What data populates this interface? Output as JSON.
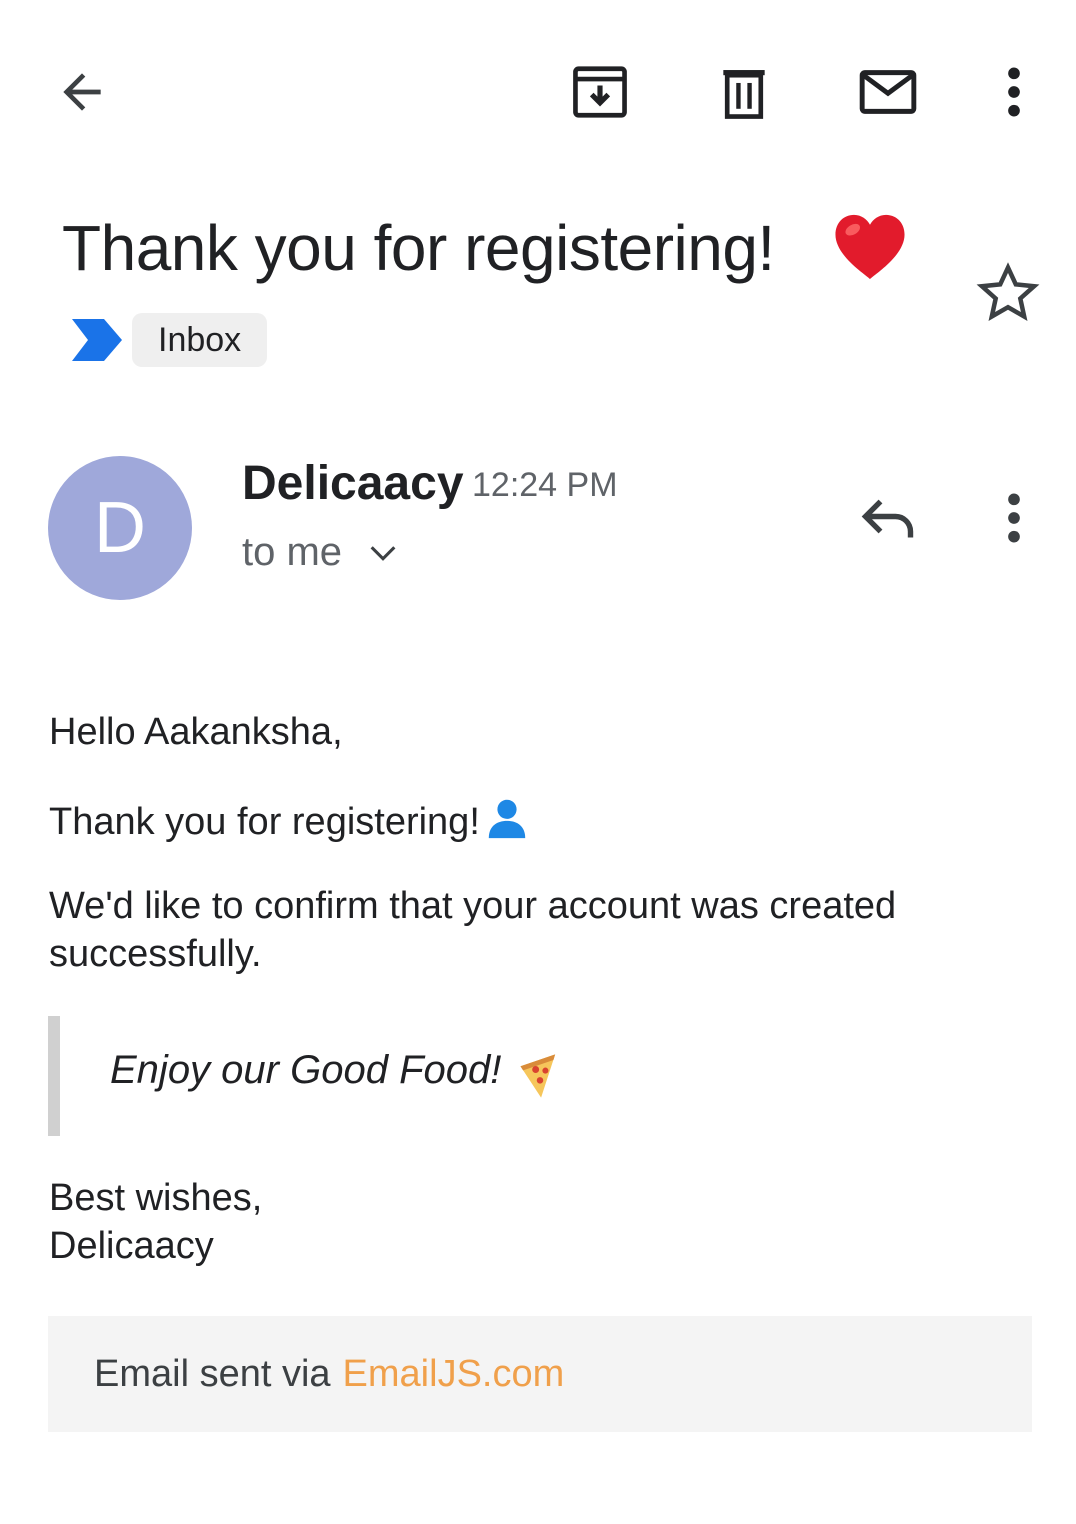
{
  "toolbar": {
    "back_icon": "arrow-back-icon",
    "archive_icon": "archive-icon",
    "delete_icon": "trash-icon",
    "mark_unread_icon": "mail-icon",
    "more_icon": "more-vertical-icon"
  },
  "email": {
    "subject": "Thank you for registering!",
    "subject_emoji": "heart-emoji",
    "label": "Inbox",
    "label_marker_color": "#1a73e8",
    "starred": false,
    "sender": {
      "initial": "D",
      "name": "Delicaacy",
      "avatar_color": "#9fa8da"
    },
    "time": "12:24 PM",
    "recipient": "to me"
  },
  "body": {
    "greeting": "Hello Aakanksha,",
    "thanks": "Thank you for registering!",
    "confirm": "We'd like to confirm that your account was created successfully.",
    "quote": "Enjoy our Good Food!",
    "signoff_line1": "Best wishes,",
    "signoff_line2": "Delicaacy"
  },
  "footer": {
    "prefix": "Email sent via",
    "link": "EmailJS.com",
    "link_color": "#f0a04b"
  }
}
